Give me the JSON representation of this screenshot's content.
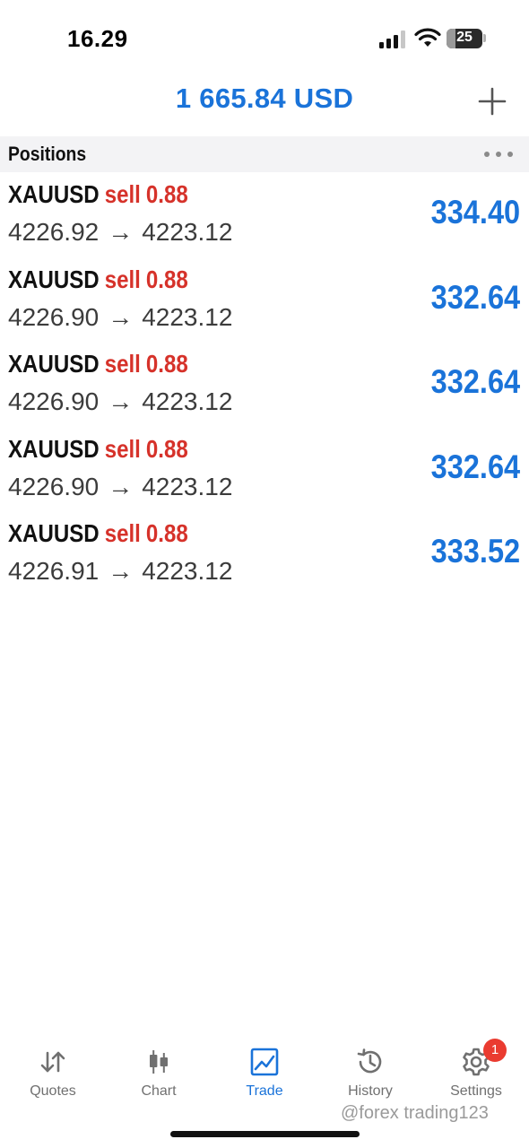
{
  "status_bar": {
    "time": "16.29",
    "battery_level": "25",
    "signal_icon": "cellular-signal-icon",
    "wifi_icon": "wifi-icon"
  },
  "header": {
    "balance": "1 665.84 USD",
    "add_icon": "plus-icon"
  },
  "positions_section": {
    "title": "Positions",
    "more_icon": "ellipsis-icon"
  },
  "positions": [
    {
      "symbol": "XAUUSD",
      "type": "sell",
      "volume": "0.88",
      "open_price": "4226.92",
      "arrow": "→",
      "current_price": "4223.12",
      "profit": "334.40"
    },
    {
      "symbol": "XAUUSD",
      "type": "sell",
      "volume": "0.88",
      "open_price": "4226.90",
      "arrow": "→",
      "current_price": "4223.12",
      "profit": "332.64"
    },
    {
      "symbol": "XAUUSD",
      "type": "sell",
      "volume": "0.88",
      "open_price": "4226.90",
      "arrow": "→",
      "current_price": "4223.12",
      "profit": "332.64"
    },
    {
      "symbol": "XAUUSD",
      "type": "sell",
      "volume": "0.88",
      "open_price": "4226.90",
      "arrow": "→",
      "current_price": "4223.12",
      "profit": "332.64"
    },
    {
      "symbol": "XAUUSD",
      "type": "sell",
      "volume": "0.88",
      "open_price": "4226.91",
      "arrow": "→",
      "current_price": "4223.12",
      "profit": "333.52"
    }
  ],
  "tabs": [
    {
      "label": "Quotes",
      "icon": "quotes-arrows-icon",
      "active": false
    },
    {
      "label": "Chart",
      "icon": "candlestick-icon",
      "active": false
    },
    {
      "label": "Trade",
      "icon": "trade-chart-icon",
      "active": true
    },
    {
      "label": "History",
      "icon": "history-clock-icon",
      "active": false
    },
    {
      "label": "Settings",
      "icon": "gear-icon",
      "active": false,
      "badge": "1"
    }
  ],
  "watermark": "@forex trading123",
  "colors": {
    "accent_blue": "#1a73d9",
    "sell_red": "#d6322a",
    "badge_red": "#ea3b30",
    "section_bg": "#f3f3f5"
  }
}
